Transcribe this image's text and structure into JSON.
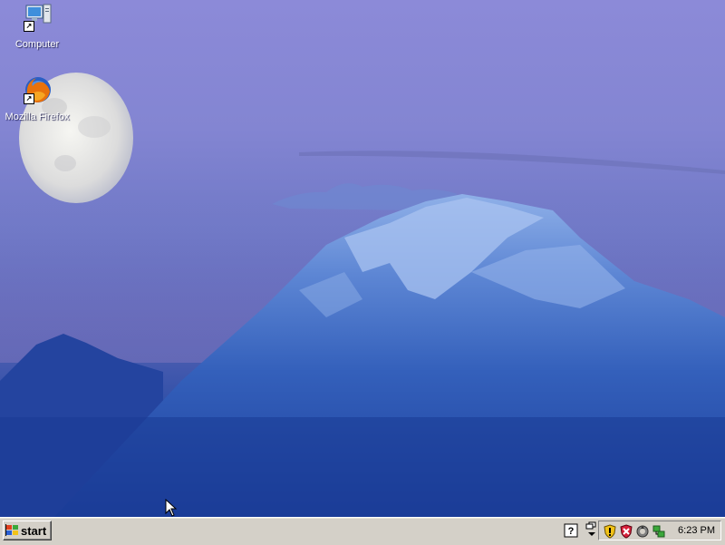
{
  "desktop": {
    "icons": [
      {
        "label": "Computer",
        "icon": "computer-icon"
      },
      {
        "label": "Mozilla Firefox",
        "icon": "firefox-icon"
      }
    ],
    "wallpaper": "moon-over-mountain"
  },
  "taskbar": {
    "start_label": "start",
    "clock": "6:23 PM",
    "tray_icons": [
      "security-shield-icon",
      "antivirus-icon",
      "update-icon",
      "network-icon"
    ],
    "quick_icons": [
      "help-icon",
      "window-switch-icon"
    ]
  },
  "colors": {
    "taskbar_bg": "#d4d0c8",
    "sky_top": "#8c8ad8",
    "mountain": "#2f5cb8"
  }
}
